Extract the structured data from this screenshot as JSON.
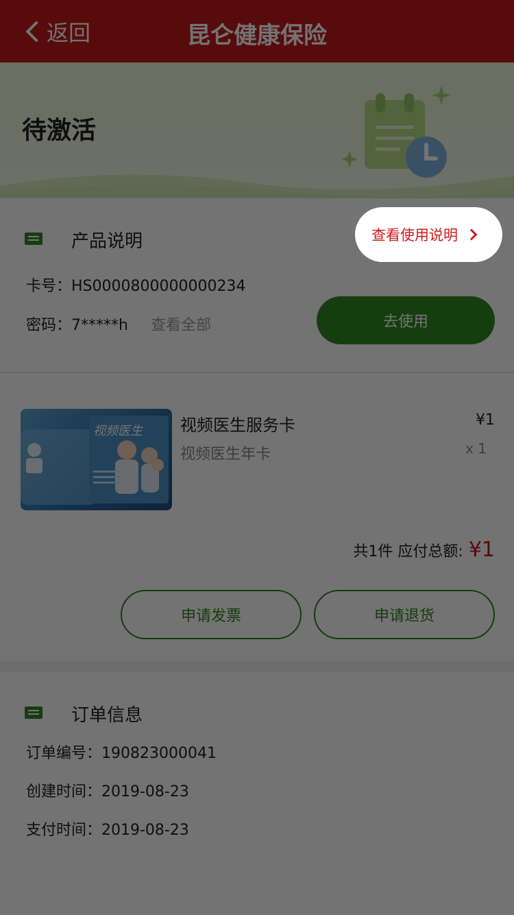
{
  "nav": {
    "back_label": "返回",
    "title": "昆仑健康保险"
  },
  "banner": {
    "status": "待激活"
  },
  "product_section": {
    "title": "产品说明",
    "guide_link": "查看使用说明",
    "card_no_label": "卡号：",
    "card_no": "HS0000800000000234",
    "password_label": "密码：",
    "password": "7*****h",
    "view_all": "查看全部",
    "use_button": "去使用"
  },
  "product": {
    "image_caption": "视频医生",
    "name": "视频医生服务卡",
    "subtitle": "视频医生年卡",
    "price": "¥1",
    "qty": "x 1",
    "total_label": "共1件 应付总额:",
    "total_value": "¥1",
    "invoice_button": "申请发票",
    "return_button": "申请退货"
  },
  "order_section": {
    "title": "订单信息",
    "order_no": "订单编号：190823000041",
    "created": "创建时间：2019-08-23",
    "paid": "支付时间：2019-08-23"
  },
  "colors": {
    "brand_red": "#c41a1a",
    "brand_green": "#2f8a1f"
  }
}
